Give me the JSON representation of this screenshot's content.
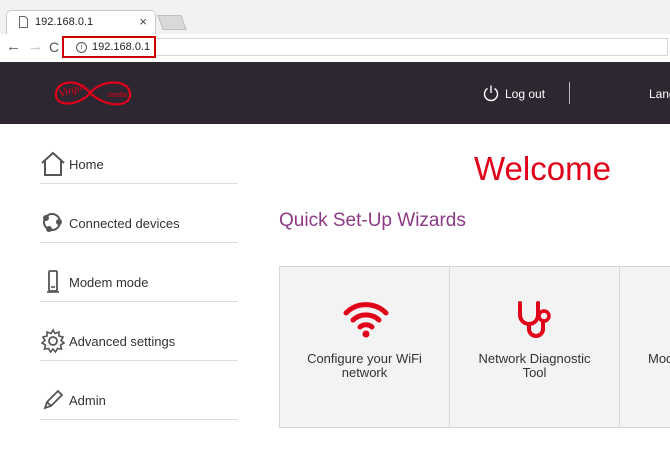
{
  "browser": {
    "tab_title": "192.168.0.1",
    "tab_close": "×",
    "url": "192.168.0.1",
    "back": "←",
    "forward": "→",
    "reload": "C",
    "info": "i"
  },
  "header": {
    "brand_logo": "Virgin media",
    "logout_label": "Log out",
    "language_label": "Lang"
  },
  "sidebar": {
    "items": [
      {
        "label": "Home",
        "icon": "home-icon"
      },
      {
        "label": "Connected devices",
        "icon": "devices-icon"
      },
      {
        "label": "Modem mode",
        "icon": "modem-icon"
      },
      {
        "label": "Advanced settings",
        "icon": "gear-icon"
      },
      {
        "label": "Admin",
        "icon": "pencil-icon"
      }
    ]
  },
  "main": {
    "welcome": "Welcome",
    "quick_setup_title": "Quick Set-Up Wizards",
    "cards": [
      {
        "label": "Configure your WiFi network",
        "icon": "wifi-icon"
      },
      {
        "label": "Network Diagnostic Tool",
        "icon": "stethoscope-icon"
      },
      {
        "label": "Mod",
        "icon": ""
      }
    ]
  },
  "colors": {
    "header_bg": "#2e2630",
    "brand_red": "#e1001a",
    "heading_purple": "#8d3a86"
  }
}
